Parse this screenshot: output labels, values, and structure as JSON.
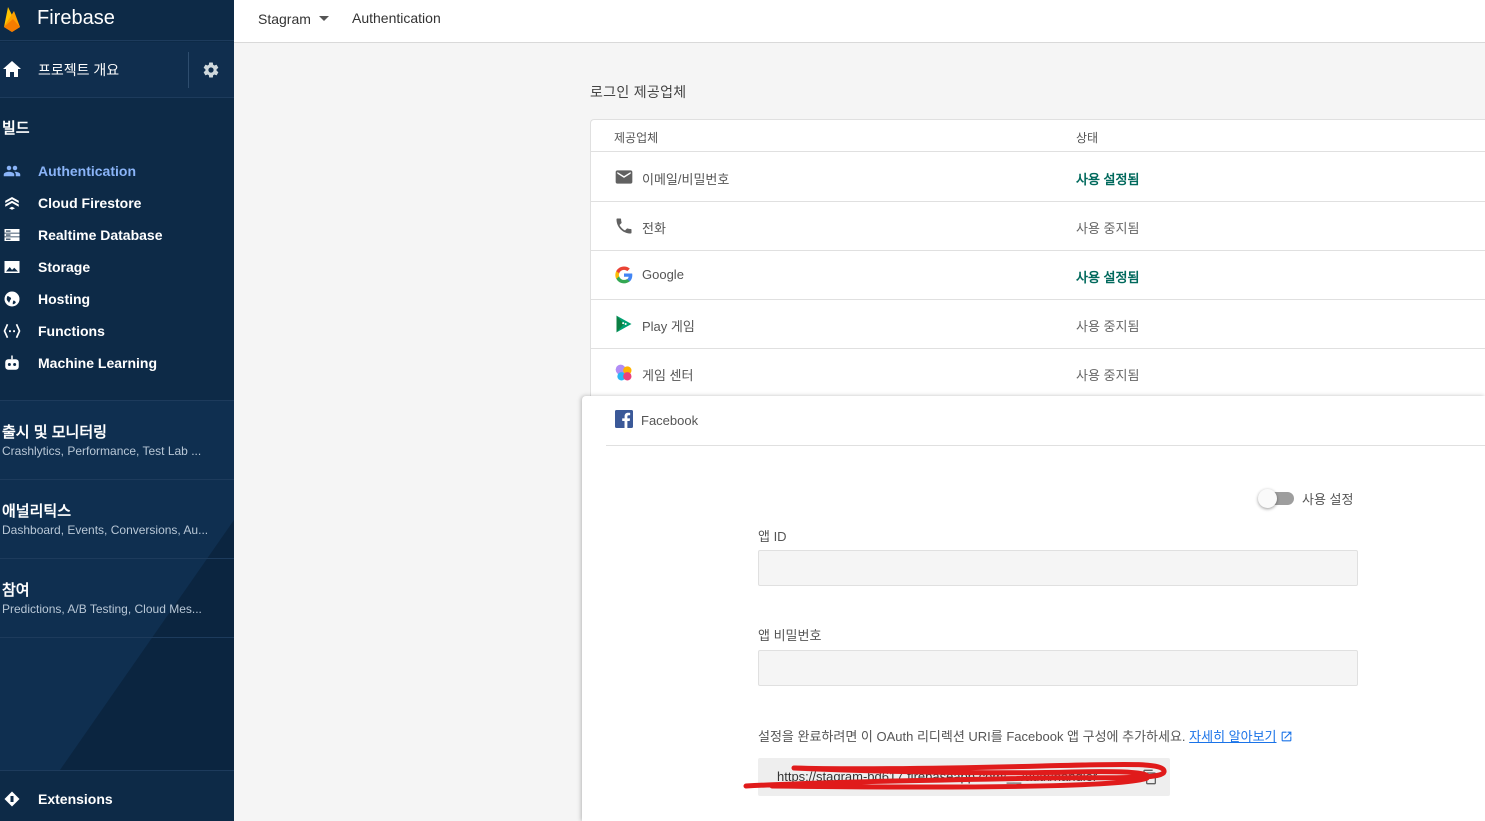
{
  "app": {
    "name": "Firebase"
  },
  "sidebar": {
    "overview_label": "프로젝트 개요",
    "build_title": "빌드",
    "items": [
      {
        "label": "Authentication",
        "icon": "people-icon",
        "active": true
      },
      {
        "label": "Cloud Firestore",
        "icon": "firestore-icon"
      },
      {
        "label": "Realtime Database",
        "icon": "database-icon"
      },
      {
        "label": "Storage",
        "icon": "image-icon"
      },
      {
        "label": "Hosting",
        "icon": "globe-icon"
      },
      {
        "label": "Functions",
        "icon": "functions-icon"
      },
      {
        "label": "Machine Learning",
        "icon": "robot-icon"
      }
    ],
    "groups": [
      {
        "title": "출시 및 모니터링",
        "subtitle": "Crashlytics, Performance, Test Lab ..."
      },
      {
        "title": "애널리틱스",
        "subtitle": "Dashboard, Events, Conversions, Au..."
      },
      {
        "title": "참여",
        "subtitle": "Predictions, A/B Testing, Cloud Mes..."
      }
    ],
    "extensions_label": "Extensions"
  },
  "topbar": {
    "project": "Stagram",
    "breadcrumb": "Authentication"
  },
  "providers": {
    "section_title": "로그인 제공업체",
    "col_provider": "제공업체",
    "col_status": "상태",
    "rows": [
      {
        "name": "이메일/비밀번호",
        "status": "사용 설정됨",
        "icon": "mail-icon",
        "enabled": true
      },
      {
        "name": "전화",
        "status": "사용 중지됨",
        "icon": "phone-icon",
        "enabled": false
      },
      {
        "name": "Google",
        "status": "사용 설정됨",
        "icon": "google-icon",
        "enabled": true
      },
      {
        "name": "Play 게임",
        "status": "사용 중지됨",
        "icon": "play-games-icon",
        "enabled": false
      },
      {
        "name": "게임 센터",
        "status": "사용 중지됨",
        "icon": "game-center-icon",
        "enabled": false
      }
    ]
  },
  "facebook_panel": {
    "name": "Facebook",
    "toggle_label": "사용 설정",
    "toggle_on": false,
    "app_id_label": "앱 ID",
    "app_id_value": "",
    "app_secret_label": "앱 비밀번호",
    "app_secret_value": "",
    "instruction": "설정을 완료하려면 이 OAuth 리디렉션 URI를 Facebook 앱 구성에 추가하세요. ",
    "learn_more": "자세히 알아보기",
    "redirect_uri": "https://stagram-bd617.firebaseapp.com/__/auth/handler"
  },
  "colors": {
    "sidebar_bg": "#0d2a47",
    "active_nav": "#8ab4f8",
    "enabled_status": "#00695c",
    "link": "#1a73e8",
    "annotation": "#e01b1b"
  }
}
